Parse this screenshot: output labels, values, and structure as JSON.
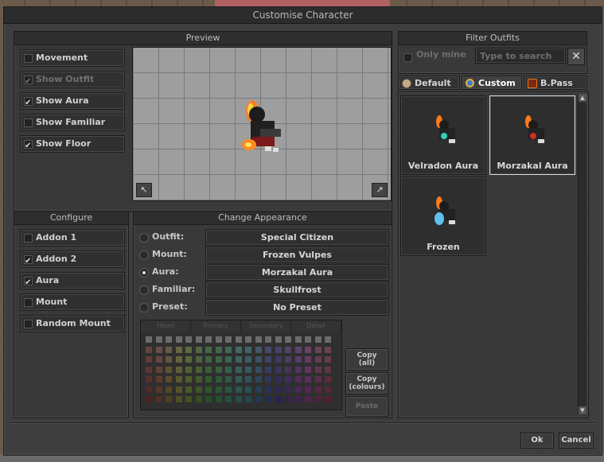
{
  "window": {
    "title": "Customise Character"
  },
  "preview": {
    "header": "Preview",
    "options": [
      {
        "label": "Movement",
        "checked": false,
        "disabled": false
      },
      {
        "label": "Show Outfit",
        "checked": true,
        "disabled": true
      },
      {
        "label": "Show Aura",
        "checked": true,
        "disabled": false
      },
      {
        "label": "Show Familiar",
        "checked": false,
        "disabled": false
      },
      {
        "label": "Show Floor",
        "checked": true,
        "disabled": false
      }
    ],
    "rotate_left_glyph": "↖",
    "rotate_right_glyph": "↗"
  },
  "configure": {
    "header": "Configure",
    "options": [
      {
        "label": "Addon 1",
        "checked": false
      },
      {
        "label": "Addon 2",
        "checked": true
      },
      {
        "label": "Aura",
        "checked": true
      },
      {
        "label": "Mount",
        "checked": false
      },
      {
        "label": "Random Mount",
        "checked": false
      }
    ]
  },
  "appearance": {
    "header": "Change Appearance",
    "rows": [
      {
        "label": "Outfit:",
        "value": "Special Citizen",
        "selected": false
      },
      {
        "label": "Mount:",
        "value": "Frozen Vulpes",
        "selected": false
      },
      {
        "label": "Aura:",
        "value": "Morzakal Aura",
        "selected": true
      },
      {
        "label": "Familiar:",
        "value": "Skullfrost",
        "selected": false
      },
      {
        "label": "Preset:",
        "value": "No Preset",
        "selected": false
      }
    ],
    "palette_tabs": [
      "Head",
      "Primary",
      "Secondary",
      "Detail"
    ],
    "buttons": {
      "copy_all_1": "Copy",
      "copy_all_2": "(all)",
      "copy_colours_1": "Copy",
      "copy_colours_2": "(colours)",
      "paste": "Paste"
    }
  },
  "filter": {
    "header": "Filter Outfits",
    "only_mine": "Only mine",
    "search_placeholder": "Type to search",
    "clear_glyph": "✕"
  },
  "tabs": [
    {
      "label": "Default",
      "icon": "default-icon",
      "color": "#c7a98a"
    },
    {
      "label": "Custom",
      "icon": "custom-icon",
      "color": "#e0b040"
    },
    {
      "label": "B.Pass",
      "icon": "battle-pass-icon",
      "color": "#e07b20"
    }
  ],
  "outfits": [
    {
      "name": "Velradon Aura",
      "selected": false,
      "glow": "#33d0b0"
    },
    {
      "name": "Morzakal Aura",
      "selected": true,
      "glow": "#d03020"
    },
    {
      "name": "Frozen",
      "selected": false,
      "glow": "#60c0f0"
    }
  ],
  "footer": {
    "ok": "Ok",
    "cancel": "Cancel"
  }
}
